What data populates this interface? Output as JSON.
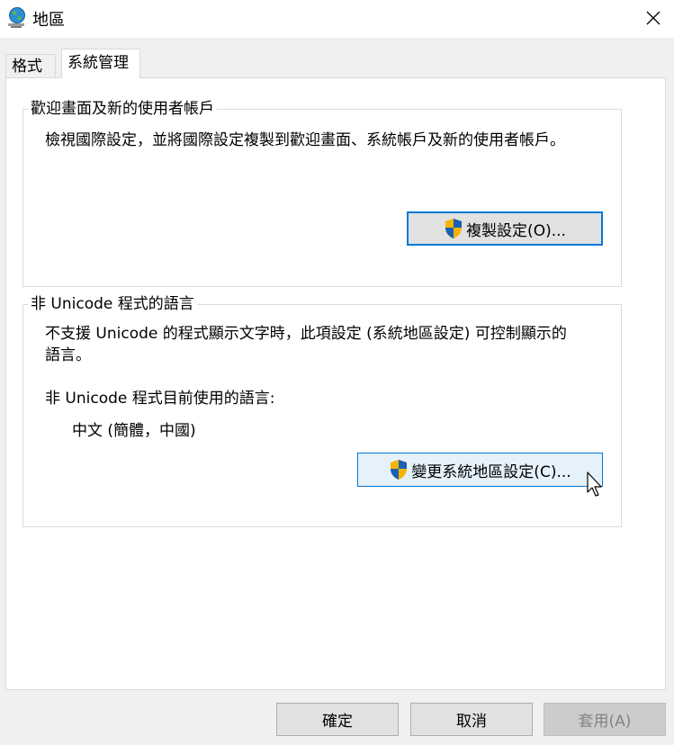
{
  "window": {
    "title": "地區",
    "icon": "globe-icon",
    "close_icon": "close-icon"
  },
  "tabs": [
    {
      "label": "格式",
      "active": false
    },
    {
      "label": "系統管理",
      "active": true
    }
  ],
  "welcome_group": {
    "legend": "歡迎畫面及新的使用者帳戶",
    "description": "檢視國際設定，並將國際設定複製到歡迎畫面、系統帳戶及新的使用者帳戶。",
    "button_label": "複製設定(O)...",
    "button_icon": "uac-shield-icon"
  },
  "unicode_group": {
    "legend": "非 Unicode 程式的語言",
    "description_line1": "不支援 Unicode 的程式顯示文字時，此項設定 (系統地區設定) 可控制顯示的",
    "description_line2": "語言。",
    "current_label": "非 Unicode 程式目前使用的語言:",
    "current_value": "中文 (簡體，中國)",
    "button_label": "變更系統地區設定(C)...",
    "button_icon": "uac-shield-icon"
  },
  "footer": {
    "ok_label": "確定",
    "cancel_label": "取消",
    "apply_label": "套用(A)"
  },
  "colors": {
    "accent": "#0078d7",
    "shield_blue": "#1a5fb4",
    "shield_yellow": "#f4b400"
  }
}
